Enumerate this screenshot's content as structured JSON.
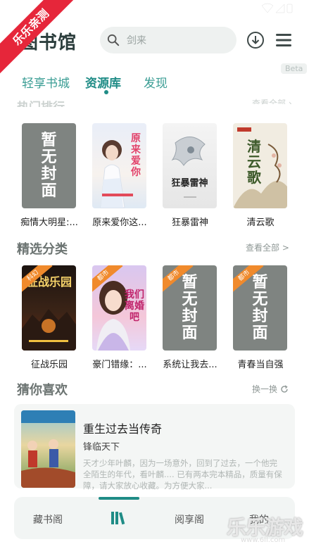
{
  "ribbon": "乐乐亲测",
  "app_title": "图书馆",
  "search": {
    "placeholder": "剑来"
  },
  "beta": "Beta",
  "tabs": [
    {
      "label": "轻享书城"
    },
    {
      "label": "资源库",
      "active": true
    },
    {
      "label": "发现"
    }
  ],
  "hot_books": [
    {
      "title": "痴情大明星:...",
      "cover": "gray",
      "cover_text": "暂无封面"
    },
    {
      "title": "原来爱你这...",
      "cover": "art-pink",
      "cover_text": "原来爱你"
    },
    {
      "title": "狂暴雷神",
      "cover": "art-dragon",
      "cover_text": "狂暴雷神"
    },
    {
      "title": "清云歌",
      "cover": "art-ink",
      "cover_text": "清云歌"
    }
  ],
  "featured": {
    "title": "精选分类",
    "link": "查看全部 >",
    "books": [
      {
        "title": "征战乐园",
        "tag": "科幻",
        "cover": "art-dark",
        "cover_text": "征战乐园"
      },
      {
        "title": "豪门错缘：...",
        "tag": "都市",
        "cover": "art-girl",
        "cover_text": "我们离婚吧"
      },
      {
        "title": "系统让我去...",
        "tag": "都市",
        "cover": "gray",
        "cover_text": "暂无封面"
      },
      {
        "title": "青春当自强",
        "tag": "都市",
        "cover": "gray",
        "cover_text": "暂无封面"
      }
    ]
  },
  "guess": {
    "title": "猜你喜欢",
    "link": "换一换",
    "item": {
      "title": "重生过去当传奇",
      "author": "锋临天下",
      "desc": "天才少年叶麟，因为一场意外，回到了过去，一个他完全陌生的年代，看叶麟.... 已有两本完本精品，质量有保障，请大家放心收藏。为方便大家..."
    }
  },
  "bottom_nav": [
    {
      "label": "藏书阁"
    },
    {
      "label": "",
      "icon": "library-icon",
      "active": true
    },
    {
      "label": "阅享阁"
    },
    {
      "label": "我的"
    }
  ],
  "watermark": {
    "text": "乐乐游戏",
    "url": "www.6ll.com"
  },
  "colors": {
    "accent": "#1f8c86",
    "ribbon": "#e6263a",
    "tag": "#f08a2c"
  }
}
